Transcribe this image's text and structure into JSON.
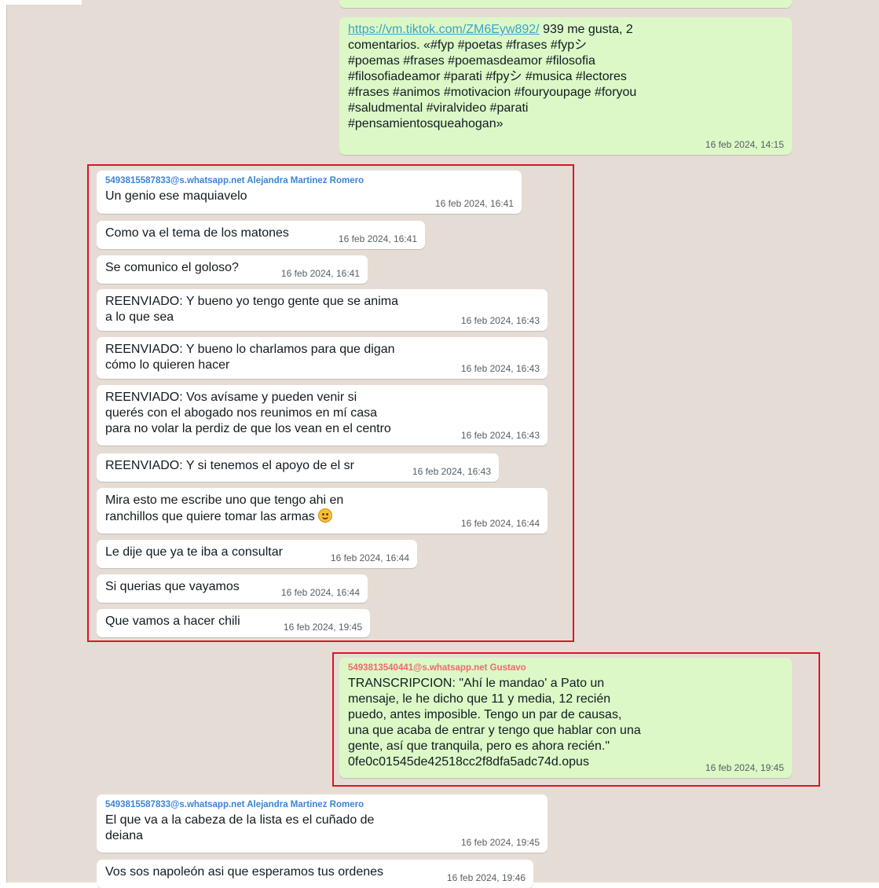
{
  "messages": [
    {
      "id": "m0",
      "direction": "outgoing",
      "link": "https://vm.tiktok.com/ZM6Eyw892/",
      "lines": [
        " 939 me gusta, 2",
        "comentarios. «#fyp #poetas #frases #fypシ",
        "#poemas #frases #poemasdeamor #filosofia",
        "#filosofiadeamor #parati #fpyシ #musica #lectores",
        "#frases #animos #motivacion #fouryoupage #foryou",
        "#saludmental #viralvideo #parati",
        "#pensamientosqueahogan»"
      ],
      "time": "16 feb 2024, 14:15"
    },
    {
      "id": "m1",
      "direction": "incoming",
      "sender": "5493815587833@s.whatsapp.net Alejandra Martinez Romero",
      "lines": [
        "Un genio ese maquiavelo"
      ],
      "time": "16 feb 2024, 16:41"
    },
    {
      "id": "m2",
      "direction": "incoming",
      "lines": [
        "Como va el tema de los matones"
      ],
      "time": "16 feb 2024, 16:41"
    },
    {
      "id": "m3",
      "direction": "incoming",
      "lines": [
        "Se comunico el goloso?"
      ],
      "time": "16 feb 2024, 16:41"
    },
    {
      "id": "m4",
      "direction": "incoming",
      "lines": [
        "REENVIADO: Y bueno yo tengo gente que se anima",
        "a lo que sea"
      ],
      "time": "16 feb 2024, 16:43"
    },
    {
      "id": "m5",
      "direction": "incoming",
      "lines": [
        "REENVIADO: Y bueno lo charlamos para que digan",
        "cómo lo quieren hacer"
      ],
      "time": "16 feb 2024, 16:43"
    },
    {
      "id": "m6",
      "direction": "incoming",
      "lines": [
        "REENVIADO: Vos avísame y pueden venir si",
        "querés con el abogado nos reunimos en mí casa",
        "para no volar la perdiz de que los vean en el centro"
      ],
      "time": "16 feb 2024, 16:43"
    },
    {
      "id": "m7",
      "direction": "incoming",
      "lines": [
        "REENVIADO: Y si tenemos el apoyo de el sr"
      ],
      "time": "16 feb 2024, 16:43"
    },
    {
      "id": "m8",
      "direction": "incoming",
      "lines": [
        "Mira esto me escribe uno que tengo ahi en",
        "ranchillos que quiere tomar las armas"
      ],
      "emoji": "smirking-face",
      "time": "16 feb 2024, 16:44"
    },
    {
      "id": "m9",
      "direction": "incoming",
      "lines": [
        "Le dije que ya te iba a consultar"
      ],
      "time": "16 feb 2024, 16:44"
    },
    {
      "id": "m10",
      "direction": "incoming",
      "lines": [
        "Si querias que vayamos"
      ],
      "time": "16 feb 2024, 16:44"
    },
    {
      "id": "m11",
      "direction": "incoming",
      "lines": [
        "Que vamos a hacer chili"
      ],
      "time": "16 feb 2024, 19:45"
    },
    {
      "id": "m12",
      "direction": "outgoing",
      "sender": "5493813540441@s.whatsapp.net Gustavo",
      "lines": [
        "TRANSCRIPCION: \"Ahí le mandao' a Pato un",
        "mensaje, le he dicho que 11 y media, 12 recién",
        "puedo, antes imposible. Tengo un par de causas,",
        "una que acaba de entrar y tengo que hablar con una",
        "gente, así que tranquila, pero es ahora recién.\"",
        "0fe0c01545de42518cc2f8dfa5adc74d.opus"
      ],
      "time": "16 feb 2024, 19:45"
    },
    {
      "id": "m13",
      "direction": "incoming",
      "sender": "5493815587833@s.whatsapp.net Alejandra Martinez Romero",
      "lines": [
        "El que va a la cabeza de la lista es el cuñado de",
        "deiana"
      ],
      "time": "16 feb 2024, 19:45"
    },
    {
      "id": "m14",
      "direction": "incoming",
      "lines": [
        "Vos sos napoleón asi que esperamos tus ordenes"
      ],
      "time": "16 feb 2024, 19:46"
    }
  ],
  "colors": {
    "chat_background": "#e5ddd5",
    "incoming_bubble": "#ffffff",
    "outgoing_bubble": "#dcf8c6",
    "sender_blue": "#3b84d8",
    "sender_red": "#f06a6a",
    "highlight_box": "#e3102a",
    "link": "#3ea3c8"
  }
}
